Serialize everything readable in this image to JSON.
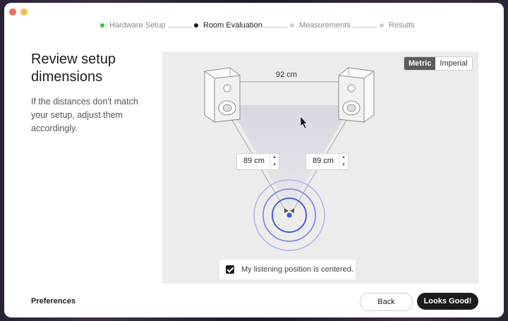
{
  "window": {
    "traffic_lights": [
      "close",
      "minimize"
    ]
  },
  "stepper": {
    "steps": [
      {
        "label": "Hardware Setup",
        "state": "done"
      },
      {
        "label": "Room Evaluation",
        "state": "active"
      },
      {
        "label": "Measurements",
        "state": "pending"
      },
      {
        "label": "Results",
        "state": "pending"
      }
    ]
  },
  "left": {
    "title": "Review setup dimensions",
    "description": "If the distances don't match your setup, adjust them accordingly."
  },
  "panel": {
    "unit_toggle": {
      "options": [
        "Metric",
        "Imperial"
      ],
      "selected": "Metric"
    },
    "speaker_distance": "92 cm",
    "left_distance": {
      "value": "89 cm"
    },
    "right_distance": {
      "value": "89 cm"
    },
    "centered_checkbox": {
      "label": "My listening position is centered.",
      "checked": true
    }
  },
  "footer": {
    "preferences": "Preferences",
    "back": "Back",
    "confirm": "Looks Good!"
  },
  "colors": {
    "accent_green": "#27c93f",
    "listener_blue": "#3b5bdb",
    "button_dark": "#1c1c1e",
    "triangle_fill": "#dcdce6"
  }
}
